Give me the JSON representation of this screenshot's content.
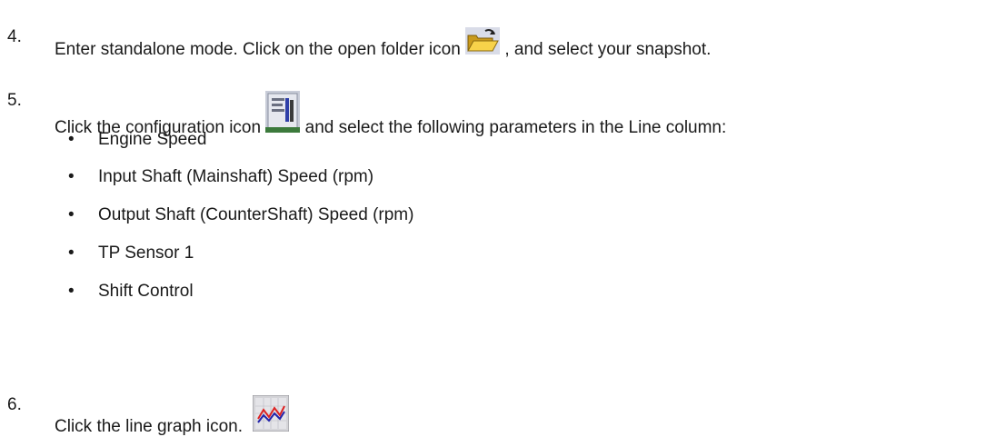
{
  "steps": [
    {
      "number": "4.",
      "text_before": "Enter standalone mode. Click on the open folder icon ",
      "icon": "open-folder-icon",
      "text_after": ", and select your snapshot."
    },
    {
      "number": "5.",
      "text_before": "Click the configuration icon ",
      "icon": "configuration-icon",
      "text_after": " and select the following parameters in the Line column:"
    },
    {
      "number": "6.",
      "text_before": "Click the line graph icon.",
      "icon": "line-graph-icon",
      "text_after": ""
    }
  ],
  "parameters": [
    "Engine Speed",
    "Input Shaft (Mainshaft) Speed (rpm)",
    "Output Shaft (CounterShaft) Speed (rpm)",
    "TP Sensor 1",
    "Shift Control"
  ],
  "bullet_char": "•"
}
